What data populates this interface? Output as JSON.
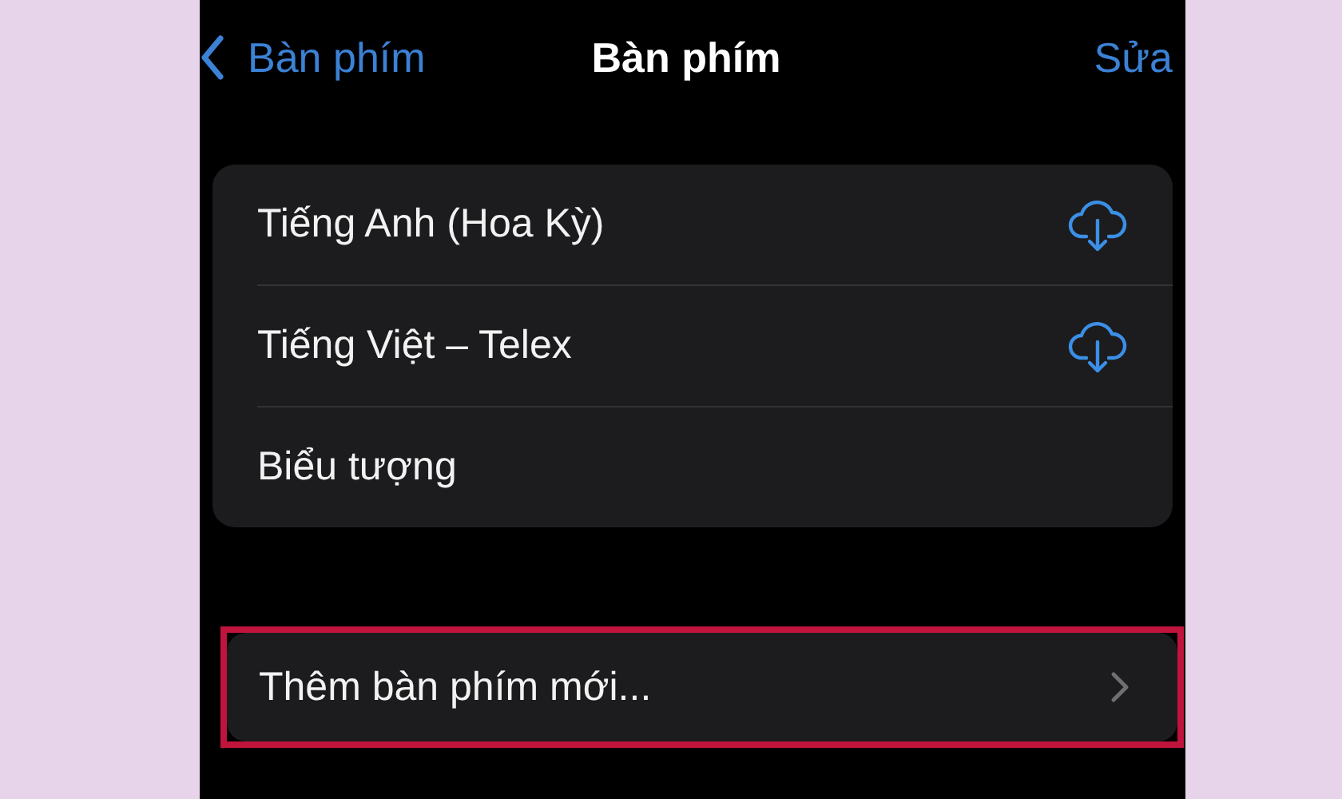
{
  "nav": {
    "back_label": "Bàn phím",
    "title": "Bàn phím",
    "action": "Sửa"
  },
  "keyboards": [
    {
      "label": "Tiếng Anh (Hoa Kỳ)",
      "downloadable": true
    },
    {
      "label": "Tiếng Việt – Telex",
      "downloadable": true
    },
    {
      "label": "Biểu tượng",
      "downloadable": false
    }
  ],
  "add_keyboard": {
    "label": "Thêm bàn phím mới...",
    "highlighted": true
  }
}
